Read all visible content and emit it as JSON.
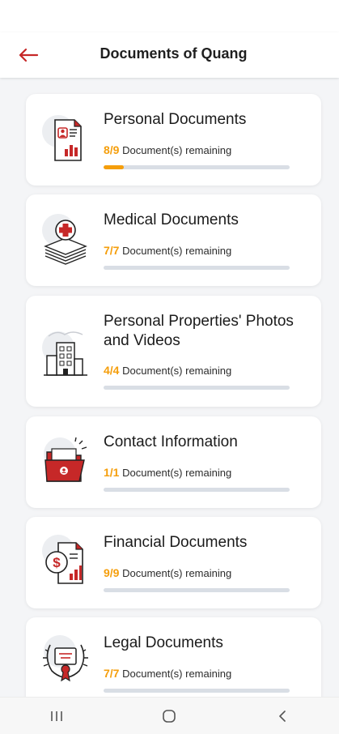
{
  "header": {
    "title": "Documents of Quang",
    "back_icon": "arrow-left-icon",
    "accent_color": "#c62828"
  },
  "progress_color": "#f59e0b",
  "categories": [
    {
      "title": "Personal Documents",
      "count": "8/9",
      "remaining_label": "Document(s) remaining",
      "progress": 0.11,
      "icon": "personal-document-icon"
    },
    {
      "title": "Medical Documents",
      "count": "7/7",
      "remaining_label": "Document(s) remaining",
      "progress": 0,
      "icon": "medical-documents-icon"
    },
    {
      "title": "Personal Properties' Photos and Videos",
      "count": "4/4",
      "remaining_label": "Document(s) remaining",
      "progress": 0,
      "icon": "building-icon"
    },
    {
      "title": "Contact Information",
      "count": "1/1",
      "remaining_label": "Document(s) remaining",
      "progress": 0,
      "icon": "folder-contact-icon"
    },
    {
      "title": "Financial Documents",
      "count": "9/9",
      "remaining_label": "Document(s) remaining",
      "progress": 0,
      "icon": "financial-document-icon"
    },
    {
      "title": "Legal Documents",
      "count": "7/7",
      "remaining_label": "Document(s) remaining",
      "progress": 0,
      "icon": "legal-certificate-icon"
    }
  ],
  "navigation": {
    "recent_icon": "recent-apps-icon",
    "home_icon": "home-icon",
    "back_icon": "back-chevron-icon"
  }
}
